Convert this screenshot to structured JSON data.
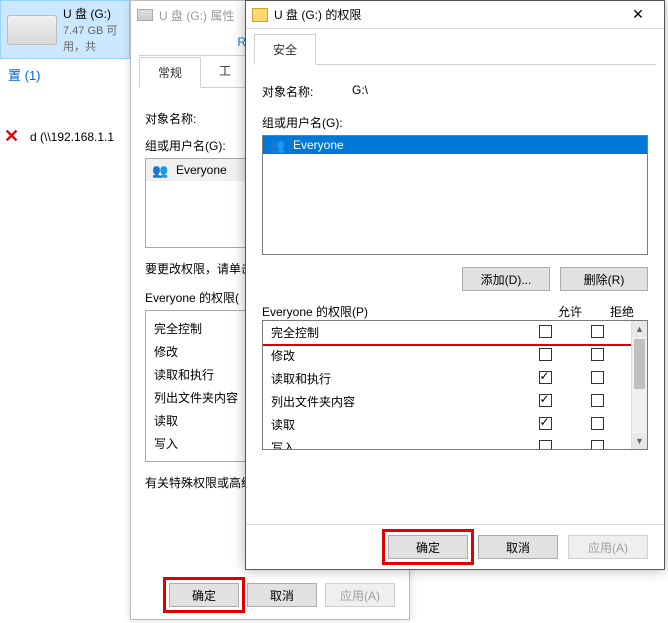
{
  "explorer": {
    "drive_label": "U 盘 (G:)",
    "drive_sub": "7.47 GB 可用，共",
    "device_count": "置 (1)",
    "net_label": "d (\\\\192.168.1.1"
  },
  "props": {
    "title": "U 盘 (G:) 属性",
    "tabs": {
      "readyboost": "ReadyBoost",
      "general": "常规",
      "tools": "工"
    },
    "object_label": "对象名称:",
    "group_label": "组或用户名(G):",
    "group_everyone": "Everyone",
    "change_note": "要更改权限，请单击",
    "perm_title": "Everyone 的权限(",
    "perm_items": [
      "完全控制",
      "修改",
      "读取和执行",
      "列出文件夹内容",
      "读取",
      "写入"
    ],
    "special_note": "有关特殊权限或高级",
    "buttons": {
      "ok": "确定",
      "cancel": "取消",
      "apply": "应用(A)"
    }
  },
  "perms": {
    "title": "U 盘 (G:) 的权限",
    "tab": "安全",
    "object_label": "对象名称:",
    "object_value": "G:\\",
    "group_label": "组或用户名(G):",
    "group_everyone": "Everyone",
    "buttons": {
      "add": "添加(D)...",
      "remove": "删除(R)",
      "ok": "确定",
      "cancel": "取消",
      "apply": "应用(A)"
    },
    "perm_title": "Everyone 的权限(P)",
    "col_allow": "允许",
    "col_deny": "拒绝",
    "rows": [
      {
        "label": "完全控制",
        "allow": false,
        "deny": false
      },
      {
        "label": "修改",
        "allow": false,
        "deny": false
      },
      {
        "label": "读取和执行",
        "allow": true,
        "deny": false
      },
      {
        "label": "列出文件夹内容",
        "allow": true,
        "deny": false
      },
      {
        "label": "读取",
        "allow": true,
        "deny": false
      },
      {
        "label": "写入",
        "allow": false,
        "deny": false
      }
    ]
  },
  "chart_data": {
    "type": "table"
  }
}
